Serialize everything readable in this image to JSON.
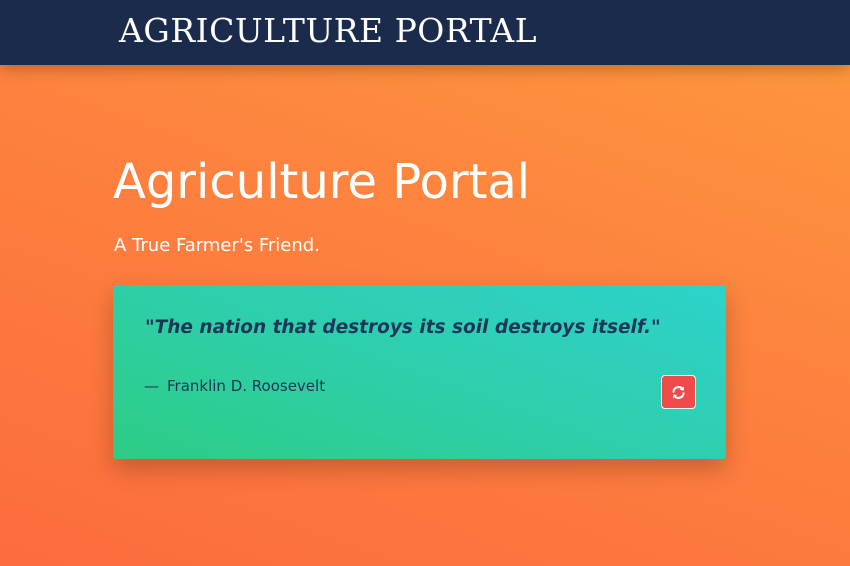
{
  "navbar": {
    "brand": "AGRICULTURE PORTAL"
  },
  "hero": {
    "title": "Agriculture Portal",
    "tagline": "A True Farmer's Friend."
  },
  "quote": {
    "text": "\"The nation that destroys its soil destroys itself.\"",
    "dash": "—",
    "author": "Franklin D. Roosevelt",
    "refresh_icon": "refresh-icon"
  },
  "colors": {
    "navbar": "#1a2b4c",
    "background_top": "#fd9a3c",
    "background_bottom": "#fc6c3d",
    "card_start": "#2ecc85",
    "card_end": "#2dd2cb",
    "quote_text": "#1d3557",
    "refresh_button": "#ef4b4b"
  }
}
